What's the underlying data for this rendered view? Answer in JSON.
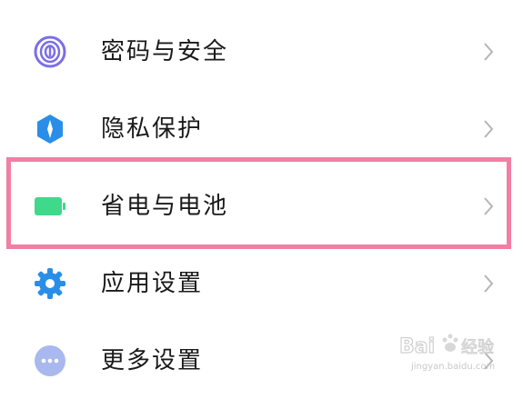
{
  "settings": {
    "items": [
      {
        "label": "密码与安全",
        "icon": "fingerprint-icon",
        "color": "#7b6fe6"
      },
      {
        "label": "隐私保护",
        "icon": "privacy-shield-icon",
        "color": "#2a8ee8"
      },
      {
        "label": "省电与电池",
        "icon": "battery-icon",
        "color": "#3ed98a"
      },
      {
        "label": "应用设置",
        "icon": "gear-icon",
        "color": "#2a8ee8"
      },
      {
        "label": "更多设置",
        "icon": "more-dots-icon",
        "color": "#a9b8ee"
      }
    ],
    "highlighted_item": "省电与电池",
    "highlight_color": "#f27fa3"
  },
  "watermark": {
    "logo_text": "Bai",
    "logo_suffix": "经验",
    "url": "jingyan.baidu.com"
  }
}
